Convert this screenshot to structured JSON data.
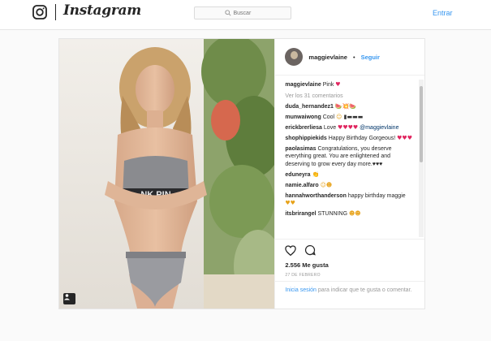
{
  "header": {
    "brand": "Instagram",
    "search_placeholder": "Buscar",
    "login_label": "Entrar"
  },
  "post": {
    "author": "maggievlaine",
    "separator": "•",
    "follow_label": "Seguir",
    "caption_user": "maggievlaine",
    "caption_text": "Pink",
    "view_all": "Ver los 31 comentarios",
    "comments": [
      {
        "user": "duda_hernandez1",
        "text": ""
      },
      {
        "user": "munwaiwong",
        "text": "Cool"
      },
      {
        "user": "erickbrerliesa",
        "text": "Love",
        "tag": "@maggievlaine"
      },
      {
        "user": "shophippiekids",
        "text": "Happy Birthday Gorgeous!"
      },
      {
        "user": "paolasimas",
        "text": "Congratulations, you deserve everything great. You are enlightened and deserving to grow every day more.♥♥♥"
      },
      {
        "user": "eduneyra",
        "text": ""
      },
      {
        "user": "namie.alfaro",
        "text": ""
      },
      {
        "user": "hannahworthanderson",
        "text": "happy birthday maggie"
      },
      {
        "user": "itsbrirangel",
        "text": "STUNNING"
      }
    ],
    "likes": "2.556 Me gusta",
    "date": "27 DE FEBRERO",
    "footer_login": "Inicia sesión",
    "footer_text": "para indicar que te gusta o comentar.",
    "photo_print": "NK PIN"
  },
  "colors": {
    "link": "#3897f0",
    "heart": "#e0245e"
  },
  "icons": [
    "instagram-logo-icon",
    "search-icon",
    "heart-icon",
    "comment-icon",
    "user-tag-icon"
  ]
}
